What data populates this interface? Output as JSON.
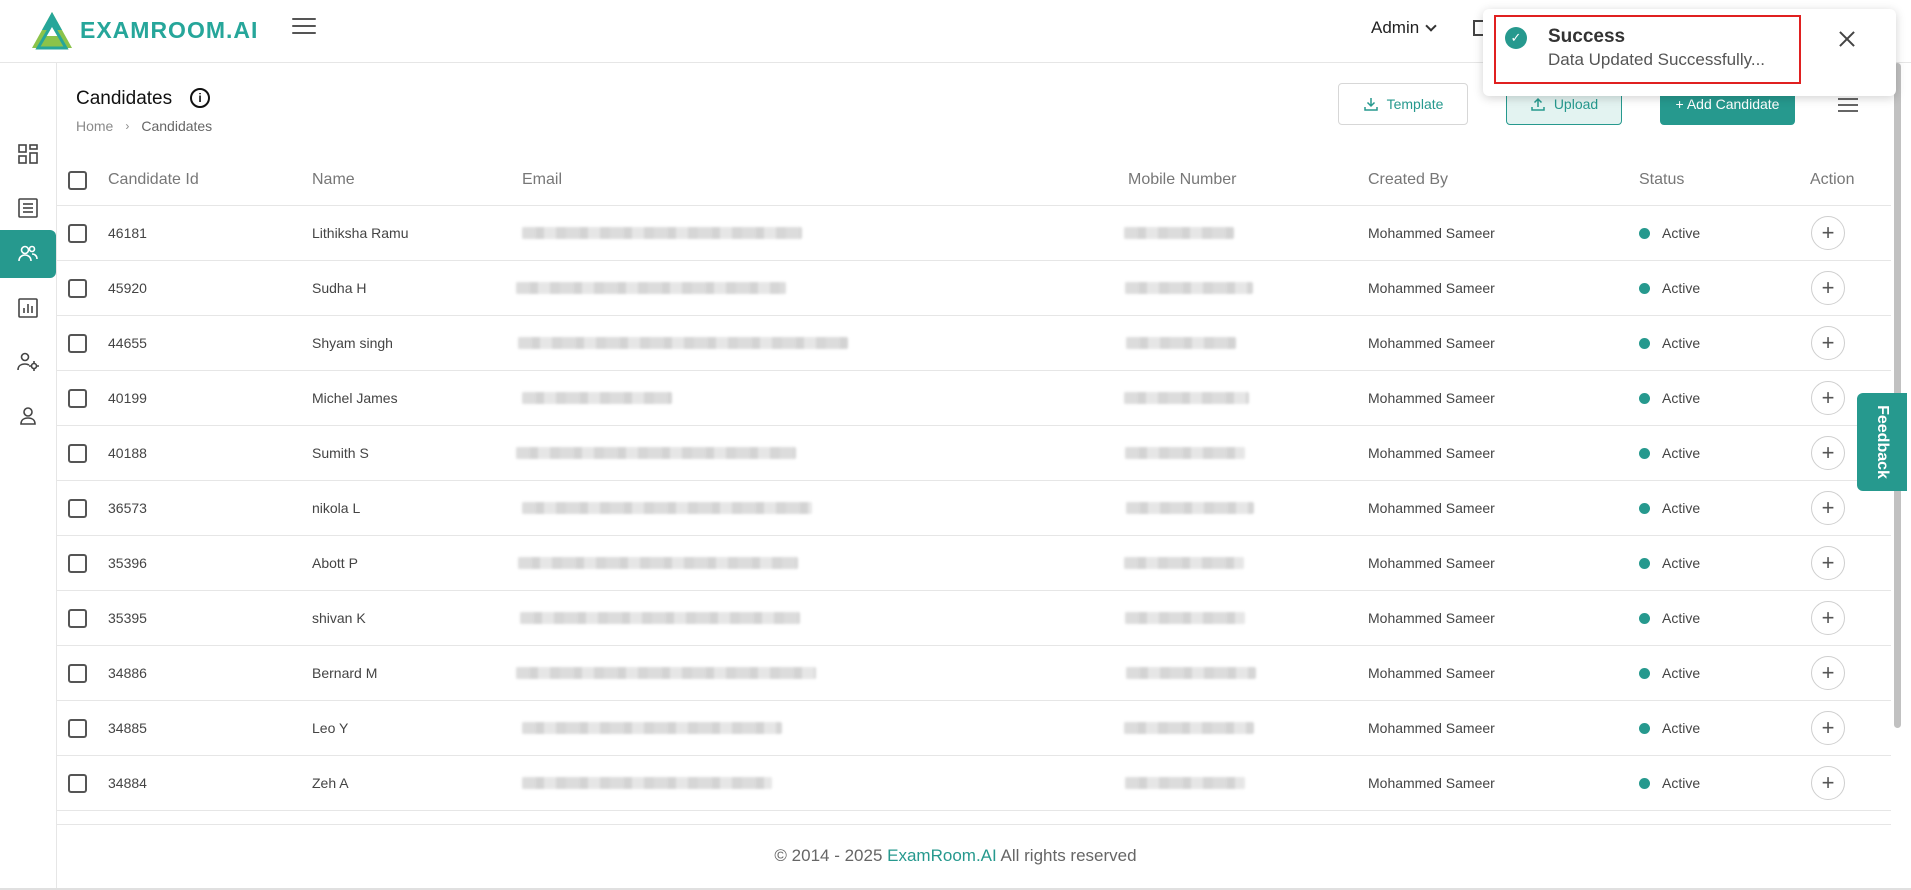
{
  "brand": {
    "logo_text": "EXAMROOM.AI",
    "accent": "#26998e"
  },
  "topbar": {
    "user_label": "Admin"
  },
  "sidebar": {
    "items": [
      {
        "icon": "dashboard-icon"
      },
      {
        "icon": "list-icon"
      },
      {
        "icon": "users-icon",
        "active": true
      },
      {
        "icon": "reports-icon"
      },
      {
        "icon": "user-settings-icon"
      },
      {
        "icon": "profile-icon"
      }
    ]
  },
  "page": {
    "title": "Candidates",
    "breadcrumb": [
      "Home",
      "Candidates"
    ],
    "buttons": {
      "template": "Template",
      "upload": "Upload",
      "add": "+ Add Candidate"
    }
  },
  "table": {
    "columns": [
      "Candidate Id",
      "Name",
      "Email",
      "Mobile Number",
      "Created By",
      "Status",
      "Action"
    ],
    "rows": [
      {
        "id": "46181",
        "name": "Lithiksha Ramu",
        "created_by": "Mohammed Sameer",
        "status": "Active"
      },
      {
        "id": "45920",
        "name": "Sudha H",
        "created_by": "Mohammed Sameer",
        "status": "Active"
      },
      {
        "id": "44655",
        "name": "Shyam singh",
        "created_by": "Mohammed Sameer",
        "status": "Active"
      },
      {
        "id": "40199",
        "name": "Michel James",
        "created_by": "Mohammed Sameer",
        "status": "Active"
      },
      {
        "id": "40188",
        "name": "Sumith S",
        "created_by": "Mohammed Sameer",
        "status": "Active"
      },
      {
        "id": "36573",
        "name": "nikola L",
        "created_by": "Mohammed Sameer",
        "status": "Active"
      },
      {
        "id": "35396",
        "name": "Abott P",
        "created_by": "Mohammed Sameer",
        "status": "Active"
      },
      {
        "id": "35395",
        "name": "shivan K",
        "created_by": "Mohammed Sameer",
        "status": "Active"
      },
      {
        "id": "34886",
        "name": "Bernard M",
        "created_by": "Mohammed Sameer",
        "status": "Active"
      },
      {
        "id": "34885",
        "name": "Leo Y",
        "created_by": "Mohammed Sameer",
        "status": "Active"
      },
      {
        "id": "34884",
        "name": "Zeh A",
        "created_by": "Mohammed Sameer",
        "status": "Active"
      }
    ]
  },
  "feedback": {
    "label": "Feedback"
  },
  "footer": {
    "prefix": "© 2014 - 2025 ",
    "brand": "ExamRoom.AI",
    "suffix": " All rights reserved"
  },
  "toast": {
    "title": "Success",
    "message": "Data Updated Successfully..."
  }
}
